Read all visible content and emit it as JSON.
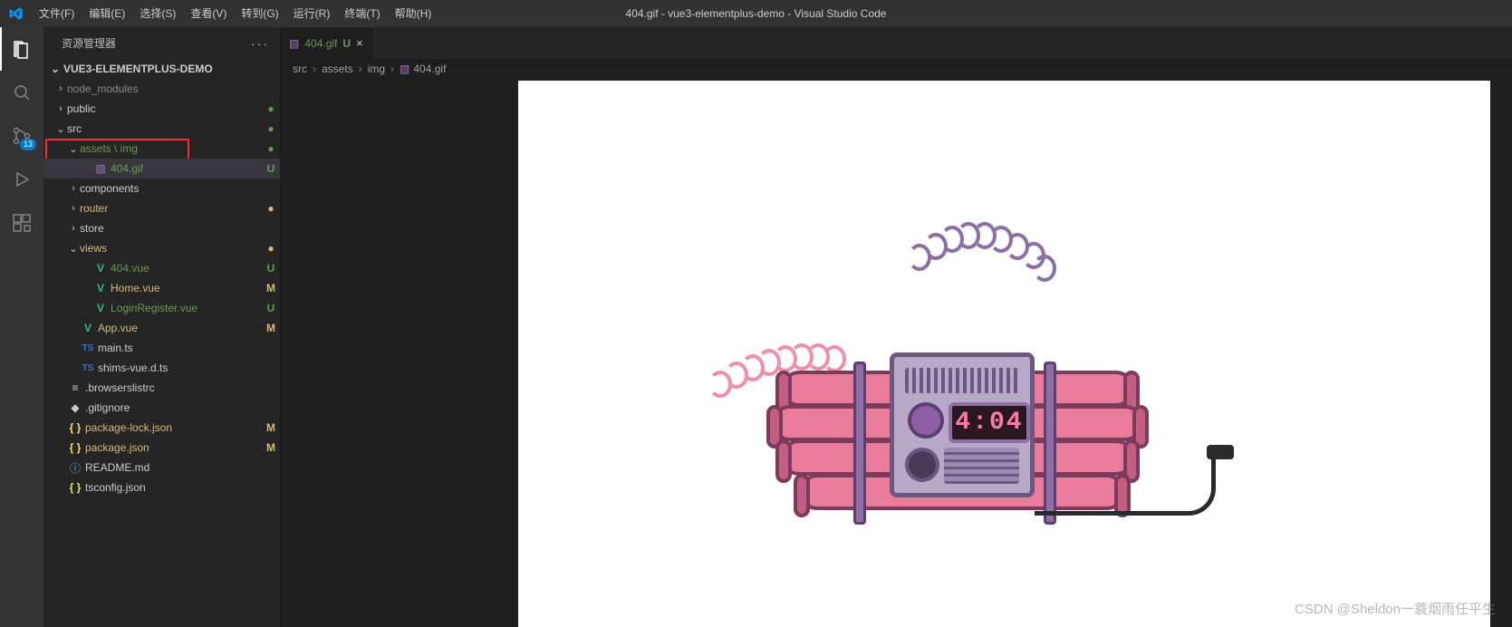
{
  "menu": {
    "items": [
      "文件(F)",
      "编辑(E)",
      "选择(S)",
      "查看(V)",
      "转到(G)",
      "运行(R)",
      "终端(T)",
      "帮助(H)"
    ]
  },
  "window_title": "404.gif - vue3-elementplus-demo - Visual Studio Code",
  "activity": {
    "scm_badge": "13"
  },
  "sidebar": {
    "title": "资源管理器",
    "project": "VUE3-ELEMENTPLUS-DEMO",
    "tree": [
      {
        "depth": 1,
        "type": "folder",
        "open": false,
        "label": "node_modules",
        "dim": true
      },
      {
        "depth": 1,
        "type": "folder",
        "open": false,
        "label": "public",
        "dot": "green"
      },
      {
        "depth": 1,
        "type": "folder",
        "open": true,
        "label": "src",
        "dot": "green"
      },
      {
        "depth": 2,
        "type": "folder",
        "open": true,
        "label": "assets \\ img",
        "dot": "green",
        "git": "folder-u",
        "hl": true
      },
      {
        "depth": 3,
        "type": "file",
        "icon": "gif",
        "label": "404.gif",
        "git": "U",
        "selected": true,
        "hl": true
      },
      {
        "depth": 2,
        "type": "folder",
        "open": false,
        "label": "components"
      },
      {
        "depth": 2,
        "type": "folder",
        "open": false,
        "label": "router",
        "git": "folder-mod",
        "dot": "orange"
      },
      {
        "depth": 2,
        "type": "folder",
        "open": false,
        "label": "store"
      },
      {
        "depth": 2,
        "type": "folder",
        "open": true,
        "label": "views",
        "git": "folder-mod",
        "dot": "orange"
      },
      {
        "depth": 3,
        "type": "file",
        "icon": "vue",
        "label": "404.vue",
        "git": "U"
      },
      {
        "depth": 3,
        "type": "file",
        "icon": "vue",
        "label": "Home.vue",
        "git": "M"
      },
      {
        "depth": 3,
        "type": "file",
        "icon": "vue",
        "label": "LoginRegister.vue",
        "git": "U"
      },
      {
        "depth": 2,
        "type": "file",
        "icon": "vue",
        "label": "App.vue",
        "git": "M"
      },
      {
        "depth": 2,
        "type": "file",
        "icon": "ts",
        "label": "main.ts"
      },
      {
        "depth": 2,
        "type": "file",
        "icon": "ts",
        "label": "shims-vue.d.ts"
      },
      {
        "depth": 1,
        "type": "file",
        "icon": "txt",
        "label": ".browserslistrc"
      },
      {
        "depth": 1,
        "type": "file",
        "icon": "git",
        "label": ".gitignore"
      },
      {
        "depth": 1,
        "type": "file",
        "icon": "json",
        "label": "package-lock.json",
        "git": "M"
      },
      {
        "depth": 1,
        "type": "file",
        "icon": "json",
        "label": "package.json",
        "git": "M"
      },
      {
        "depth": 1,
        "type": "file",
        "icon": "info",
        "label": "README.md"
      },
      {
        "depth": 1,
        "type": "file",
        "icon": "json",
        "label": "tsconfig.json"
      }
    ]
  },
  "tab": {
    "icon": "gif",
    "label": "404.gif",
    "status": "U"
  },
  "breadcrumbs": [
    "src",
    "assets",
    "img",
    "404.gif"
  ],
  "image_display": "4:04",
  "watermark": "CSDN @Sheldon一蓑烟雨任平生"
}
